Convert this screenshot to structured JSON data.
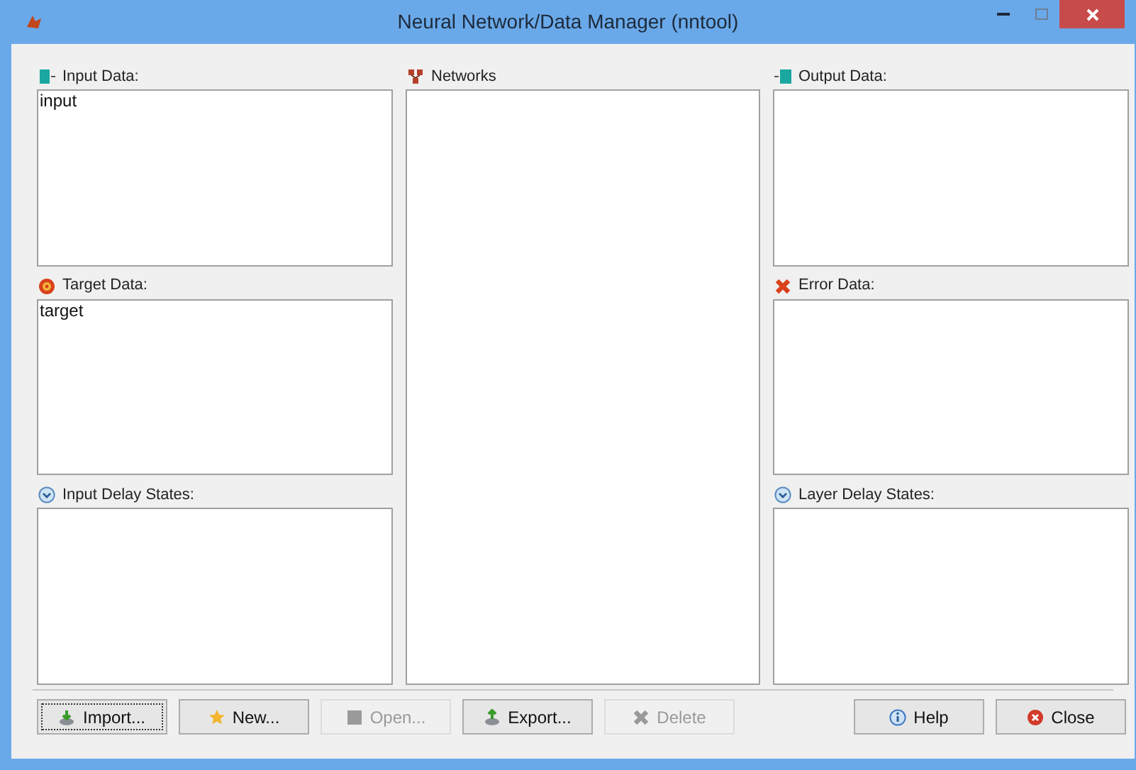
{
  "window": {
    "title": "Neural Network/Data Manager (nntool)"
  },
  "columns": [
    {
      "panels": [
        {
          "kind": "input",
          "label": "Input Data:",
          "items": [
            "input"
          ]
        },
        {
          "kind": "target",
          "label": "Target Data:",
          "items": [
            "target"
          ]
        },
        {
          "kind": "delay",
          "label": "Input Delay States:"
        }
      ]
    },
    {
      "panels": [
        {
          "kind": "network",
          "label": "Networks"
        }
      ]
    },
    {
      "panels": [
        {
          "kind": "output",
          "label": "Output Data:"
        },
        {
          "kind": "error",
          "label": "Error Data:"
        },
        {
          "kind": "delay",
          "label": "Layer Delay States:"
        }
      ]
    }
  ],
  "buttons_left": [
    {
      "kind": "import",
      "label": "Import...",
      "disabled": false,
      "focused": true
    },
    {
      "kind": "new",
      "label": "New...",
      "disabled": false,
      "focused": false
    },
    {
      "kind": "open",
      "label": "Open...",
      "disabled": true,
      "focused": false
    },
    {
      "kind": "export",
      "label": "Export...",
      "disabled": false,
      "focused": false
    },
    {
      "kind": "delete",
      "label": "Delete",
      "disabled": true,
      "focused": false
    }
  ],
  "buttons_right": [
    {
      "kind": "help",
      "label": "Help",
      "disabled": false,
      "focused": false
    },
    {
      "kind": "close",
      "label": "Close",
      "disabled": false,
      "focused": false
    }
  ]
}
